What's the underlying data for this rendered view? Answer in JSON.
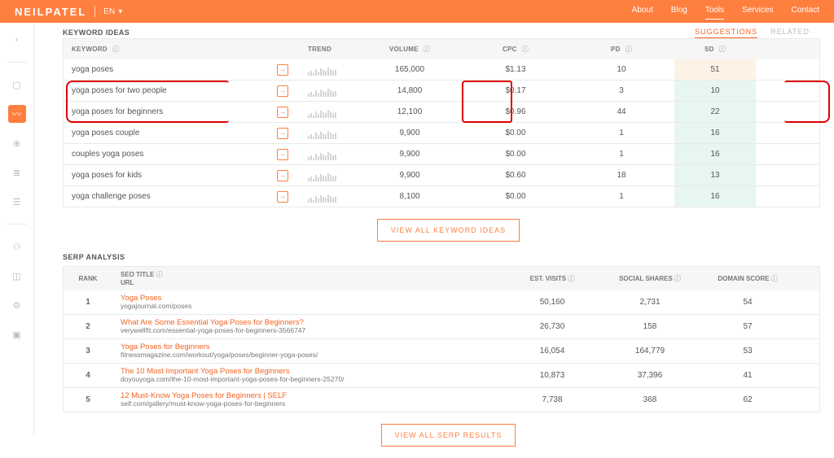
{
  "header": {
    "brand": "NEILPATEL",
    "lang": "EN",
    "nav": {
      "about": "About",
      "blog": "Blog",
      "tools": "Tools",
      "services": "Services",
      "contact": "Contact"
    }
  },
  "section_keyword_ideas": "KEYWORD IDEAS",
  "tabs": {
    "suggestions": "SUGGESTIONS",
    "related": "RELATED"
  },
  "kw_columns": {
    "keyword": "KEYWORD",
    "trend": "TREND",
    "volume": "VOLUME",
    "cpc": "CPC",
    "pd": "PD",
    "sd": "SD"
  },
  "keywords": [
    {
      "keyword": "yoga poses",
      "volume": "165,000",
      "cpc": "$1.13",
      "pd": "10",
      "sd": "51",
      "sd_class": "beige"
    },
    {
      "keyword": "yoga poses for two people",
      "volume": "14,800",
      "cpc": "$0.17",
      "pd": "3",
      "sd": "10",
      "sd_class": "green"
    },
    {
      "keyword": "yoga poses for beginners",
      "volume": "12,100",
      "cpc": "$0.96",
      "pd": "44",
      "sd": "22",
      "sd_class": "green"
    },
    {
      "keyword": "yoga poses couple",
      "volume": "9,900",
      "cpc": "$0.00",
      "pd": "1",
      "sd": "16",
      "sd_class": "green"
    },
    {
      "keyword": "couples yoga poses",
      "volume": "9,900",
      "cpc": "$0.00",
      "pd": "1",
      "sd": "16",
      "sd_class": "green"
    },
    {
      "keyword": "yoga poses for kids",
      "volume": "9,900",
      "cpc": "$0.60",
      "pd": "18",
      "sd": "13",
      "sd_class": "green"
    },
    {
      "keyword": "yoga challenge poses",
      "volume": "8,100",
      "cpc": "$0.00",
      "pd": "1",
      "sd": "16",
      "sd_class": "green"
    }
  ],
  "btn_view_keywords": "VIEW ALL KEYWORD IDEAS",
  "section_serp": "SERP ANALYSIS",
  "serp_columns": {
    "rank": "RANK",
    "title_url_a": "SEO TITLE",
    "title_url_b": "URL",
    "est_visits": "EST. VISITS",
    "social": "SOCIAL SHARES",
    "domain": "DOMAIN SCORE"
  },
  "serp": [
    {
      "rank": "1",
      "title": "Yoga Poses",
      "url": "yogajournal.com/poses",
      "visits": "50,160",
      "shares": "2,731",
      "score": "54"
    },
    {
      "rank": "2",
      "title": "What Are Some Essential Yoga Poses for Beginners?",
      "url": "verywellfit.com/essential-yoga-poses-for-beginners-3566747",
      "visits": "26,730",
      "shares": "158",
      "score": "57"
    },
    {
      "rank": "3",
      "title": "Yoga Poses for Beginners",
      "url": "fitnessmagazine.com/workout/yoga/poses/beginner-yoga-poses/",
      "visits": "16,054",
      "shares": "164,779",
      "score": "53"
    },
    {
      "rank": "4",
      "title": "The 10 Most Important Yoga Poses for Beginners",
      "url": "doyouyoga.com/the-10-most-important-yoga-poses-for-beginners-25270/",
      "visits": "10,873",
      "shares": "37,396",
      "score": "41"
    },
    {
      "rank": "5",
      "title": "12 Must-Know Yoga Poses for Beginners | SELF",
      "url": "self.com/gallery/must-know-yoga-poses-for-beginners",
      "visits": "7,738",
      "shares": "368",
      "score": "62"
    }
  ],
  "btn_view_serp": "VIEW ALL SERP RESULTS",
  "chart_data": {
    "type": "table",
    "title": "Keyword Ideas",
    "columns": [
      "keyword",
      "volume",
      "cpc",
      "pd",
      "sd"
    ],
    "rows": [
      [
        "yoga poses",
        165000,
        1.13,
        10,
        51
      ],
      [
        "yoga poses for two people",
        14800,
        0.17,
        3,
        10
      ],
      [
        "yoga poses for beginners",
        12100,
        0.96,
        44,
        22
      ],
      [
        "yoga poses couple",
        9900,
        0.0,
        1,
        16
      ],
      [
        "couples yoga poses",
        9900,
        0.0,
        1,
        16
      ],
      [
        "yoga poses for kids",
        9900,
        0.6,
        18,
        13
      ],
      [
        "yoga challenge poses",
        8100,
        0.0,
        1,
        16
      ]
    ]
  }
}
